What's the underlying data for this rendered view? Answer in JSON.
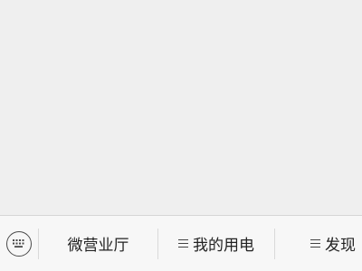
{
  "menu": {
    "items": [
      {
        "label": "微营业厅",
        "has_submenu": false
      },
      {
        "label": "我的用电",
        "has_submenu": true
      },
      {
        "label": "发现",
        "has_submenu": true
      }
    ]
  },
  "icons": {
    "keyboard": "keyboard-icon",
    "submenu": "menu-lines-icon"
  }
}
